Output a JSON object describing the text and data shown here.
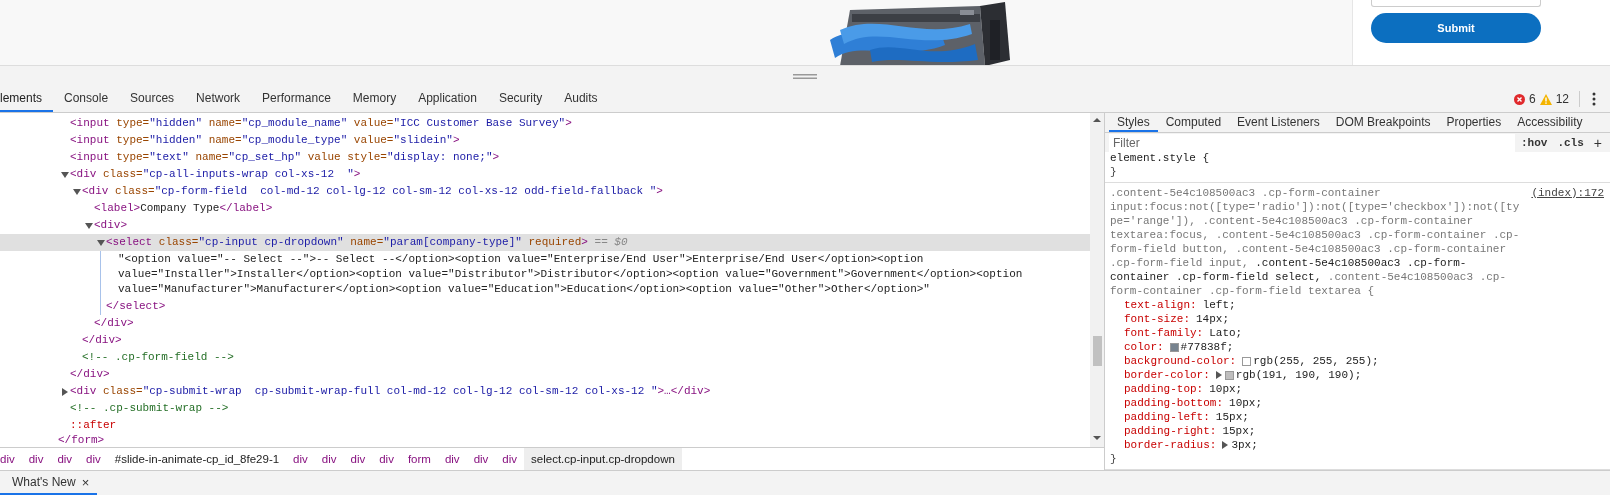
{
  "page": {
    "submit_label": "Submit"
  },
  "devtools": {
    "tabs": [
      {
        "label": "lements",
        "selected": true
      },
      {
        "label": "Console",
        "selected": false
      },
      {
        "label": "Sources",
        "selected": false
      },
      {
        "label": "Network",
        "selected": false
      },
      {
        "label": "Performance",
        "selected": false
      },
      {
        "label": "Memory",
        "selected": false
      },
      {
        "label": "Application",
        "selected": false
      },
      {
        "label": "Security",
        "selected": false
      },
      {
        "label": "Audits",
        "selected": false
      }
    ],
    "error_count": "6",
    "warning_count": "12"
  },
  "dom": {
    "nodes": [
      {
        "selected": false,
        "open": [
          {
            "kind": "tag",
            "text": "<input"
          },
          {
            "kind": "attr",
            "text": " type="
          },
          {
            "kind": "value",
            "text": "\"hidden\""
          },
          {
            "kind": "attr",
            "text": " name="
          },
          {
            "kind": "value",
            "text": "\"cp_module_name\""
          },
          {
            "kind": "attr",
            "text": " value="
          },
          {
            "kind": "value",
            "text": "\"ICC Customer Base Survey\""
          },
          {
            "kind": "tag",
            "text": ">"
          }
        ]
      },
      {
        "selected": false,
        "open": [
          {
            "kind": "tag",
            "text": "<input"
          },
          {
            "kind": "attr",
            "text": " type="
          },
          {
            "kind": "value",
            "text": "\"hidden\""
          },
          {
            "kind": "attr",
            "text": " name="
          },
          {
            "kind": "value",
            "text": "\"cp_module_type\""
          },
          {
            "kind": "attr",
            "text": " value="
          },
          {
            "kind": "value",
            "text": "\"slidein\""
          },
          {
            "kind": "tag",
            "text": ">"
          }
        ]
      },
      {
        "selected": false,
        "open": [
          {
            "kind": "tag",
            "text": "<input"
          },
          {
            "kind": "attr",
            "text": " type="
          },
          {
            "kind": "value",
            "text": "\"text\""
          },
          {
            "kind": "attr",
            "text": " name="
          },
          {
            "kind": "value",
            "text": "\"cp_set_hp\""
          },
          {
            "kind": "attr",
            "text": " value style="
          },
          {
            "kind": "value",
            "text": "\"display: none;\""
          },
          {
            "kind": "tag",
            "text": ">"
          }
        ]
      },
      {
        "selected": false,
        "expanded": true,
        "open": [
          {
            "kind": "tag",
            "text": "<div"
          },
          {
            "kind": "attr",
            "text": " class="
          },
          {
            "kind": "value",
            "text": "\"cp-all-inputs-wrap col-xs-12  \""
          },
          {
            "kind": "tag",
            "text": ">"
          }
        ],
        "children": [
          {
            "selected": false,
            "expanded": true,
            "open": [
              {
                "kind": "tag",
                "text": "<div"
              },
              {
                "kind": "attr",
                "text": " class="
              },
              {
                "kind": "value",
                "text": "\"cp-form-field  col-md-12 col-lg-12 col-sm-12 col-xs-12 odd-field-fallback \""
              },
              {
                "kind": "tag",
                "text": ">"
              }
            ],
            "children": [
              {
                "selected": false,
                "open": [
                  {
                    "kind": "tag",
                    "text": "<label>"
                  },
                  {
                    "kind": "text",
                    "text": "Company Type"
                  },
                  {
                    "kind": "tag",
                    "text": "</label>"
                  }
                ]
              },
              {
                "selected": false,
                "expanded": true,
                "open": [
                  {
                    "kind": "tag",
                    "text": "<div>"
                  }
                ],
                "children": [
                  {
                    "selected": true,
                    "expanded": true,
                    "open": [
                      {
                        "kind": "tag",
                        "text": "<select"
                      },
                      {
                        "kind": "attr",
                        "text": " class="
                      },
                      {
                        "kind": "value",
                        "text": "\"cp-input cp-dropdown\""
                      },
                      {
                        "kind": "attr",
                        "text": " name="
                      },
                      {
                        "kind": "value",
                        "text": "\"param[company-type]\""
                      },
                      {
                        "kind": "attr",
                        "text": " required"
                      },
                      {
                        "kind": "tag",
                        "text": ">"
                      },
                      {
                        "kind": "hint",
                        "text": " == $0"
                      }
                    ],
                    "children": [
                      {
                        "selected": false,
                        "open": [
                          {
                            "kind": "text",
                            "text": "\"<option value=\"-- Select --\">-- Select --</option><option value=\"Enterprise/End User\">Enterprise/End User</option><option value=\"Installer\">Installer</option><option value=\"Distributor\">Distributor</option><option value=\"Government\">Government</option><option value=\"Manufacturer\">Manufacturer</option><option value=\"Education\">Education</option><option value=\"Other\">Other</option>\""
                          }
                        ]
                      }
                    ],
                    "close": [
                      {
                        "kind": "tag",
                        "text": "</select>"
                      }
                    ]
                  }
                ],
                "close": [
                  {
                    "kind": "tag",
                    "text": "</div>"
                  }
                ]
              }
            ],
            "close": [
              {
                "kind": "tag",
                "text": "</div>"
              }
            ]
          },
          {
            "selected": false,
            "open": [
              {
                "kind": "comment",
                "text": "<!-- .cp-form-field -->"
              }
            ]
          }
        ],
        "close": [
          {
            "kind": "tag",
            "text": "</div>"
          }
        ]
      },
      {
        "selected": false,
        "expanded": false,
        "open": [
          {
            "kind": "tag",
            "text": "<div"
          },
          {
            "kind": "attr",
            "text": " class="
          },
          {
            "kind": "value",
            "text": "\"cp-submit-wrap  cp-submit-wrap-full col-md-12 col-lg-12 col-sm-12 col-xs-12 \""
          },
          {
            "kind": "tag",
            "text": ">…</div>"
          }
        ]
      },
      {
        "selected": false,
        "open": [
          {
            "kind": "comment",
            "text": "<!-- .cp-submit-wrap -->"
          }
        ]
      },
      {
        "selected": false,
        "open": [
          {
            "kind": "pseudo",
            "text": "::after"
          }
        ]
      }
    ],
    "close": [
      {
        "kind": "tag",
        "text": "</form>"
      }
    ]
  },
  "breadcrumbs": [
    {
      "label": "div",
      "kind": "tag",
      "selected": false
    },
    {
      "label": "div",
      "kind": "tag",
      "selected": false
    },
    {
      "label": "div",
      "kind": "tag",
      "selected": false
    },
    {
      "label": "div",
      "kind": "tag",
      "selected": false
    },
    {
      "label": "#slide-in-animate-cp_id_8fe29-1",
      "kind": "id",
      "selected": false
    },
    {
      "label": "div",
      "kind": "tag",
      "selected": false
    },
    {
      "label": "div",
      "kind": "tag",
      "selected": false
    },
    {
      "label": "div",
      "kind": "tag",
      "selected": false
    },
    {
      "label": "div",
      "kind": "tag",
      "selected": false
    },
    {
      "label": "form",
      "kind": "tag",
      "selected": false
    },
    {
      "label": "div",
      "kind": "tag",
      "selected": false
    },
    {
      "label": "div",
      "kind": "tag",
      "selected": false
    },
    {
      "label": "div",
      "kind": "tag",
      "selected": false
    },
    {
      "label": "select.cp-input.cp-dropdown",
      "kind": "selector",
      "selected": true
    }
  ],
  "styles": {
    "tabs": [
      {
        "label": "Styles",
        "selected": true
      },
      {
        "label": "Computed",
        "selected": false
      },
      {
        "label": "Event Listeners",
        "selected": false
      },
      {
        "label": "DOM Breakpoints",
        "selected": false
      },
      {
        "label": "Properties",
        "selected": false
      },
      {
        "label": "Accessibility",
        "selected": false
      }
    ],
    "filter": {
      "placeholder": "Filter"
    },
    "hov": ":hov",
    "cls": ".cls",
    "add": "+",
    "rules": [
      {
        "selector": [
          {
            "text": "element.style {",
            "matched": true
          }
        ],
        "close": "}"
      },
      {
        "source": "(index):172",
        "selector": [
          {
            "text": ".content-5e4c108500ac3 .cp-form-container input:focus:not([type='radio']):not([type='checkbox']):not([type='range']),",
            "matched": false
          },
          {
            "text": " .content-5e4c108500ac3 .cp-form-container textarea:focus,",
            "matched": false
          },
          {
            "text": " .content-5e4c108500ac3 .cp-form-container .cp-form-field button,",
            "matched": false
          },
          {
            "text": " .content-5e4c108500ac3 .cp-form-container .cp-form-field input,",
            "matched": false
          },
          {
            "text": " .content-5e4c108500ac3 .cp-form-container .cp-form-field select,",
            "matched": true
          },
          {
            "text": " .content-5e4c108500ac3 .cp-form-container .cp-form-field textarea {",
            "matched": false
          }
        ],
        "declarations": [
          {
            "property": "text-align:",
            "value": "left;"
          },
          {
            "property": "font-size:",
            "value": "14px;"
          },
          {
            "property": "font-family:",
            "value": "Lato;"
          },
          {
            "property": "color:",
            "value": "#77838f;",
            "color": "#77838f"
          },
          {
            "property": "background-color:",
            "value": "rgb(255, 255, 255);",
            "color": "#ffffff"
          },
          {
            "property": "border-color:",
            "value": "rgb(191, 190, 190);",
            "color": "#bfbebe",
            "expandable": true
          },
          {
            "property": "padding-top:",
            "value": "10px;"
          },
          {
            "property": "padding-bottom:",
            "value": "10px;"
          },
          {
            "property": "padding-left:",
            "value": "15px;"
          },
          {
            "property": "padding-right:",
            "value": "15px;"
          },
          {
            "property": "border-radius:",
            "value": "3px;",
            "expandable": true
          }
        ],
        "close": "}"
      }
    ]
  },
  "drawer": {
    "tabs": [
      {
        "label": "What's New",
        "selected": true
      }
    ],
    "close": "×"
  }
}
